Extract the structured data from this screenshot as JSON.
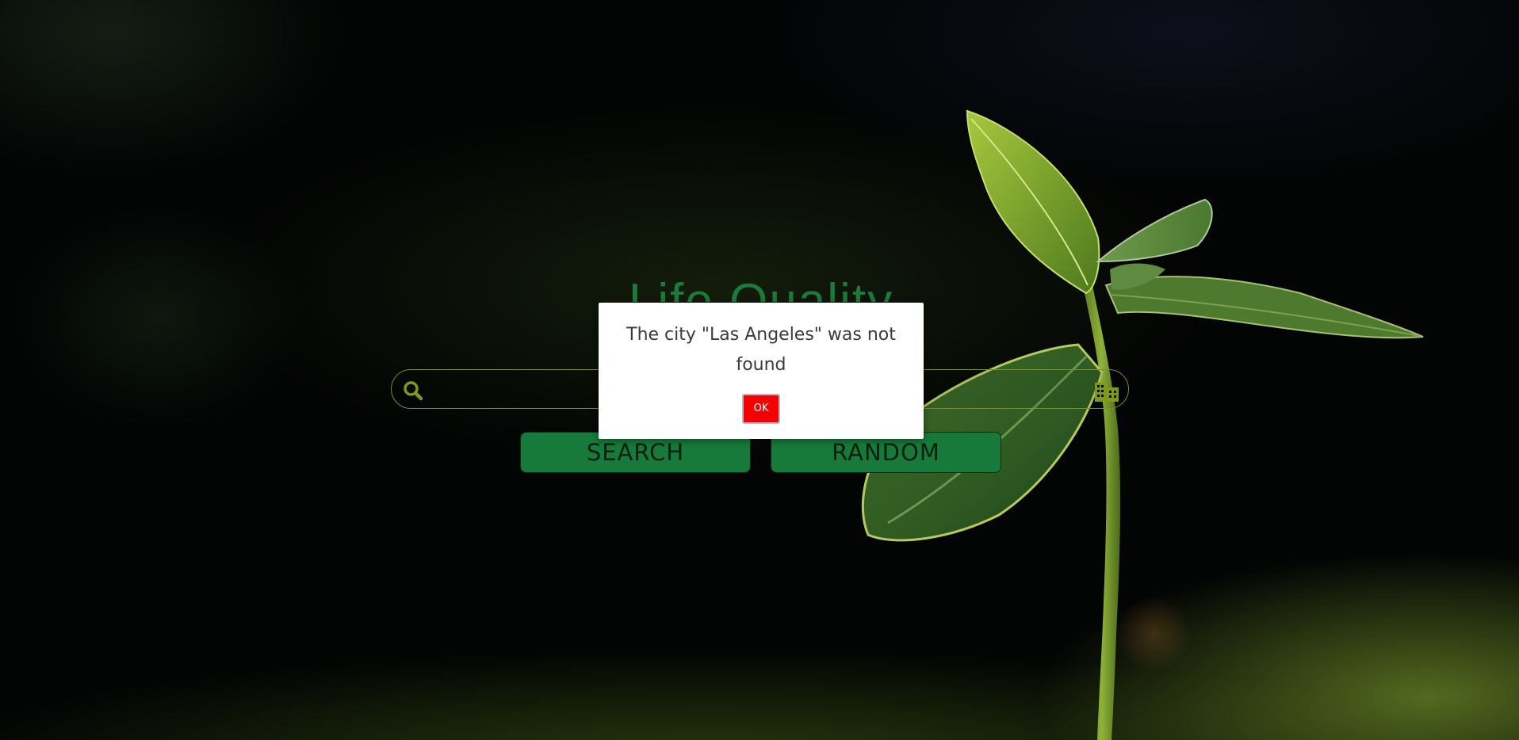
{
  "app": {
    "title": "Life Quality"
  },
  "search": {
    "value": "",
    "placeholder": "",
    "icon": "search-icon",
    "city_icon": "city-icon"
  },
  "buttons": {
    "search_label": "SEARCH",
    "random_label": "RANDOM"
  },
  "dialog": {
    "message": "The city \"Las Angeles\" was not found",
    "ok_label": "OK"
  },
  "colors": {
    "accent_green": "#177a3a",
    "icon_olive": "#7f9a1a",
    "dialog_ok": "#f50000"
  }
}
